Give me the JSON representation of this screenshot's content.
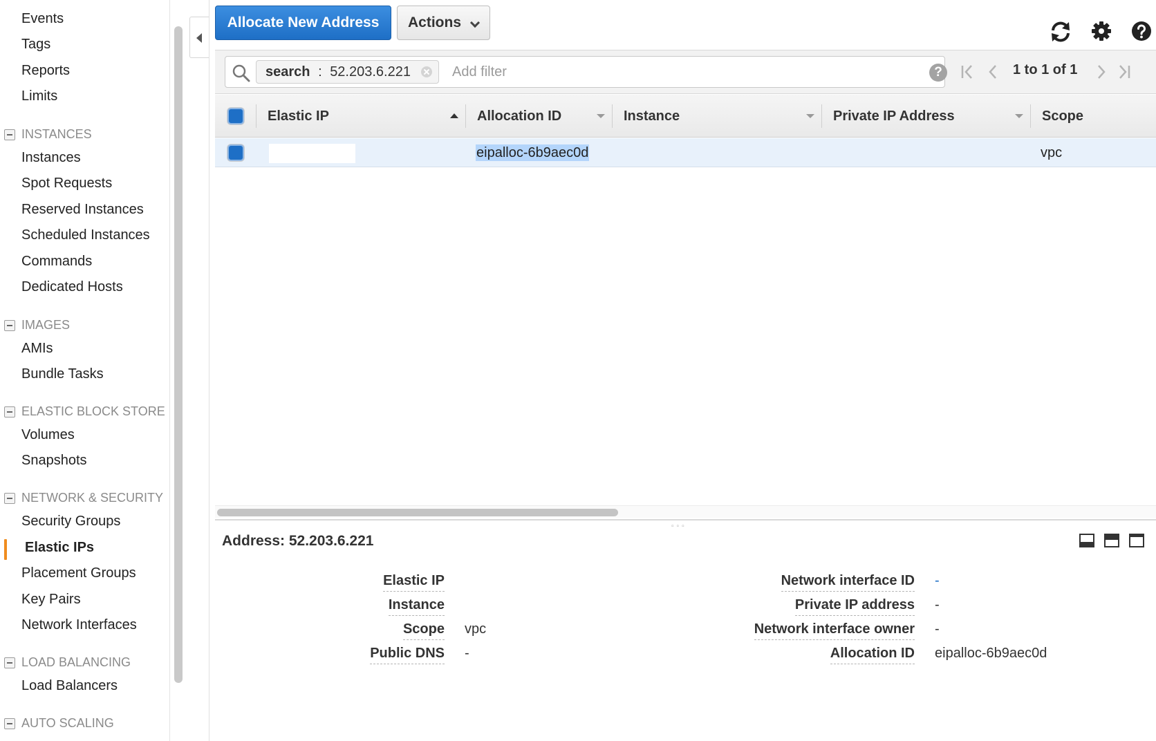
{
  "sidebar": {
    "items_top": [
      "Events",
      "Tags",
      "Reports",
      "Limits"
    ],
    "sections": [
      {
        "title": "INSTANCES",
        "items": [
          "Instances",
          "Spot Requests",
          "Reserved Instances",
          "Scheduled Instances",
          "Commands",
          "Dedicated Hosts"
        ]
      },
      {
        "title": "IMAGES",
        "items": [
          "AMIs",
          "Bundle Tasks"
        ]
      },
      {
        "title": "ELASTIC BLOCK STORE",
        "items": [
          "Volumes",
          "Snapshots"
        ]
      },
      {
        "title": "NETWORK & SECURITY",
        "items": [
          "Security Groups",
          "Elastic IPs",
          "Placement Groups",
          "Key Pairs",
          "Network Interfaces"
        ]
      },
      {
        "title": "LOAD BALANCING",
        "items": [
          "Load Balancers"
        ]
      },
      {
        "title": "AUTO SCALING",
        "items": []
      }
    ],
    "active_item": "Elastic IPs"
  },
  "toolbar": {
    "allocate_label": "Allocate New Address",
    "actions_label": "Actions",
    "icons": [
      "refresh-icon",
      "gear-icon",
      "help-icon"
    ]
  },
  "filter": {
    "token_key": "search",
    "token_sep": ":",
    "token_value": "52.203.6.221",
    "placeholder": "Add filter",
    "help_glyph": "?"
  },
  "pagination": {
    "range_text": "1 to 1 of 1"
  },
  "table": {
    "columns": [
      "Elastic IP",
      "Allocation ID",
      "Instance",
      "Private IP Address",
      "Scope"
    ],
    "rows": [
      {
        "elastic_ip": "",
        "allocation_id": "eipalloc-6b9aec0d",
        "instance": "",
        "private_ip": "",
        "scope": "vpc"
      }
    ]
  },
  "details": {
    "title": "Address: 52.203.6.221",
    "left": [
      {
        "label": "Elastic IP",
        "value": ""
      },
      {
        "label": "Instance",
        "value": ""
      },
      {
        "label": "Scope",
        "value": "vpc"
      },
      {
        "label": "Public DNS",
        "value": "-"
      }
    ],
    "right": [
      {
        "label": "Network interface ID",
        "value": "-"
      },
      {
        "label": "Private IP address",
        "value": "-"
      },
      {
        "label": "Network interface owner",
        "value": "-"
      },
      {
        "label": "Allocation ID",
        "value": "eipalloc-6b9aec0d"
      }
    ]
  },
  "colors": {
    "primary_button": "#1e6fc6",
    "active_nav_marker": "#f08c1e",
    "selected_row": "#e8f1fb"
  }
}
